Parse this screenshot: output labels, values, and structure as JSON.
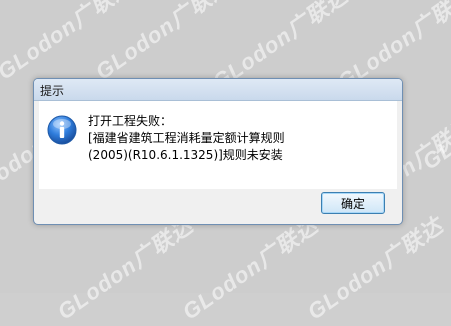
{
  "watermarks": [
    "GLodon广联达",
    "GLodon广联达",
    "GLodon广联达",
    "GLodon广联达",
    "GLodon广联达",
    "GLodon广联达",
    "GLodon广联达",
    "GLodon广联达",
    "GLodon广联达",
    "GLodon广联达",
    "GLodon广联达",
    "GLodon广联达"
  ],
  "dialog": {
    "title": "提示",
    "icon": "information-icon",
    "message_lines": [
      "打开工程失败：",
      "[福建省建筑工程消耗量定额计算规则",
      "(2005)(R10.6.1.1325)]规则未安装"
    ],
    "ok_label": "确定"
  },
  "colors": {
    "background": "#cdcdcd",
    "title_bar": "#c9d9ec",
    "info_icon": "#2a6fcf",
    "button_border": "#3c7fb1"
  }
}
